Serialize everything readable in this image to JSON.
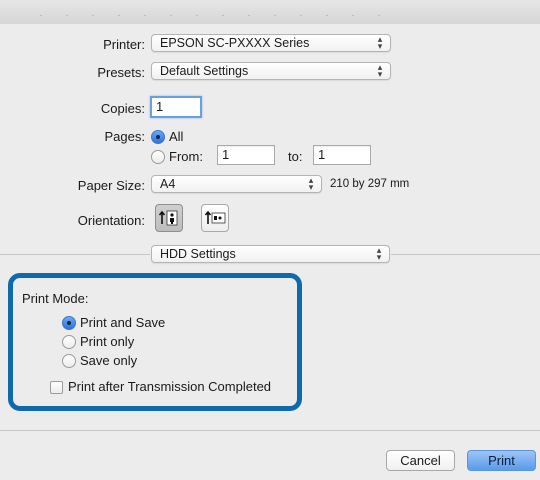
{
  "printer": {
    "label": "Printer:",
    "value": "EPSON SC-PXXXX Series"
  },
  "presets": {
    "label": "Presets:",
    "value": "Default Settings"
  },
  "copies": {
    "label": "Copies:",
    "value": "1"
  },
  "pages": {
    "label": "Pages:",
    "all_label": "All",
    "from_label": "From:",
    "from_value": "1",
    "to_label": "to:",
    "to_value": "1",
    "selected": "All"
  },
  "paper_size": {
    "label": "Paper Size:",
    "value": "A4",
    "dimensions": "210 by 297 mm"
  },
  "orientation": {
    "label": "Orientation:",
    "selected": "portrait"
  },
  "section_popup": {
    "value": "HDD Settings"
  },
  "print_mode": {
    "label": "Print Mode:",
    "options": [
      "Print and Save",
      "Print only",
      "Save only"
    ],
    "selected": "Print and Save",
    "checkbox_label": "Print after Transmission Completed",
    "checkbox_checked": false
  },
  "buttons": {
    "cancel": "Cancel",
    "print": "Print"
  },
  "colors": {
    "highlight_border": "#0f6aad",
    "default_button": "#5a9bea",
    "radio_on": "#2f72d8"
  },
  "icons": {
    "popup_arrows": "updown-chevron-icon",
    "portrait": "portrait-orientation-icon",
    "landscape": "landscape-orientation-icon"
  }
}
